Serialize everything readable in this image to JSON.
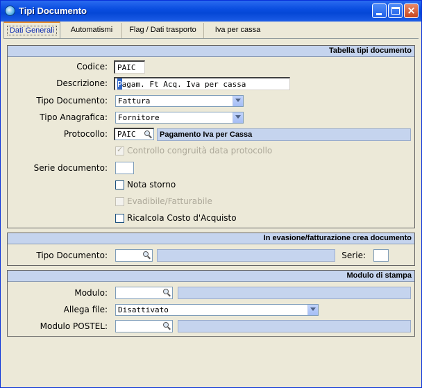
{
  "window": {
    "title": "Tipi Documento"
  },
  "tabs": [
    {
      "label": "Dati Generali"
    },
    {
      "label": "Automatismi"
    },
    {
      "label": "Flag / Dati trasporto"
    },
    {
      "label": "Iva per cassa"
    }
  ],
  "section_general": {
    "header": "Tabella tipi documento",
    "codice_label": "Codice:",
    "codice_value": "PAIC",
    "descrizione_label": "Descrizione:",
    "descrizione_first": "P",
    "descrizione_rest": "agam. Ft Acq. Iva per cassa",
    "tipo_documento_label": "Tipo Documento:",
    "tipo_documento_value": "Fattura",
    "tipo_anagrafica_label": "Tipo Anagrafica:",
    "tipo_anagrafica_value": "Fornitore",
    "protocollo_label": "Protocollo:",
    "protocollo_value": "PAIC",
    "protocollo_desc": "Pagamento Iva per Cassa",
    "controllo_label": "Controllo congruità data protocollo",
    "controllo_checked": true,
    "serie_label": "Serie documento:",
    "serie_value": "",
    "nota_storno_label": "Nota storno",
    "evadibile_label": "Evadibile/Fatturabile",
    "ricalcola_label": "Ricalcola Costo d'Acquisto"
  },
  "section_evasione": {
    "header": "In evasione/fatturazione crea documento",
    "tipo_documento_label": "Tipo Documento:",
    "tipo_documento_value": "",
    "serie_label": "Serie:",
    "serie_value": ""
  },
  "section_stampa": {
    "header": "Modulo di stampa",
    "modulo_label": "Modulo:",
    "modulo_value": "",
    "allega_label": "Allega file:",
    "allega_value": "Disattivato",
    "postel_label": "Modulo POSTEL:",
    "postel_value": ""
  },
  "icons": {
    "app": "document-icon",
    "lookup": "magnifier-icon",
    "dropdown": "chevron-down-icon"
  },
  "colors": {
    "titlebar": "#0a4ee0",
    "section_header": "#c5d4ee",
    "window_bg": "#ece9d8",
    "active_tab_accent": "#e68b2c"
  }
}
